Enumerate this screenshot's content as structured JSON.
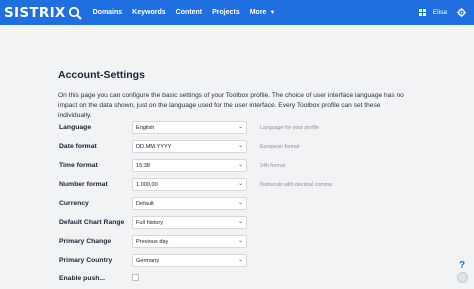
{
  "header": {
    "logo_text": "SISTRIX",
    "nav": [
      {
        "label": "Domains"
      },
      {
        "label": "Keywords"
      },
      {
        "label": "Content"
      },
      {
        "label": "Projects"
      },
      {
        "label": "More"
      }
    ],
    "user_name": "Elisa"
  },
  "page": {
    "title": "Account-Settings",
    "intro": "On this page you can configure the basic settings of your Toolbox profile. The choice of user interface language has no impact on the data shown, just on the language used for the user interface. Every Toolbox profile can set these individually."
  },
  "settings": [
    {
      "label": "Language",
      "value": "English",
      "hint": "Language for your profile"
    },
    {
      "label": "Date format",
      "value": "DD.MM.YYYY",
      "hint": "European format"
    },
    {
      "label": "Time format",
      "value": "15:38",
      "hint": "24h format"
    },
    {
      "label": "Number format",
      "value": "1.000,00",
      "hint": "Numerals with decimal comma"
    },
    {
      "label": "Currency",
      "value": "Default",
      "hint": ""
    },
    {
      "label": "Default Chart Range",
      "value": "Full history",
      "hint": ""
    },
    {
      "label": "Primary Change",
      "value": "Previous day",
      "hint": ""
    },
    {
      "label": "Primary Country",
      "value": "Germany",
      "hint": ""
    },
    {
      "label": "Enable push...",
      "value": "",
      "hint": ""
    }
  ],
  "help": {
    "label": "?"
  },
  "colors": {
    "brand": "#1f6fe0",
    "background": "#f2f3f5"
  }
}
